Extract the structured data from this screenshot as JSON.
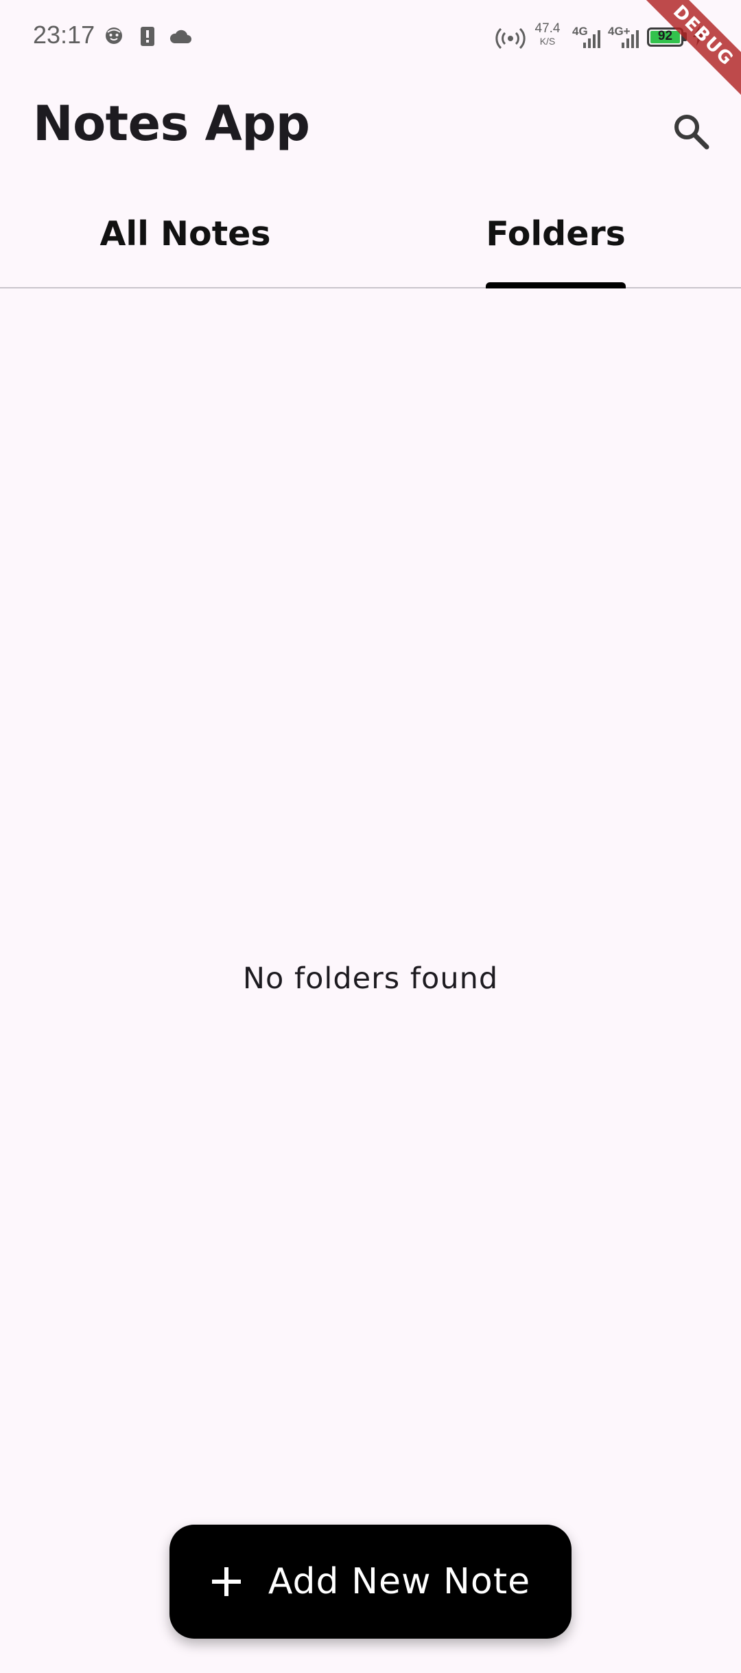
{
  "status_bar": {
    "time": "23:17",
    "net_speed_value": "47.4",
    "net_speed_unit": "K/S",
    "signal_1_label": "4G",
    "signal_2_label": "4G+",
    "battery_level": "92",
    "icons": [
      "face-notification-icon",
      "sim-alert-icon",
      "cloud-icon",
      "hotspot-icon",
      "signal-icon",
      "signal-icon",
      "battery-icon",
      "charging-icon"
    ],
    "battery_color": "#33c24d"
  },
  "debug_banner": "DEBUG",
  "app_bar": {
    "title": "Notes App",
    "search_icon": "search-icon"
  },
  "tabs": [
    {
      "label": "All Notes",
      "selected": false
    },
    {
      "label": "Folders",
      "selected": true
    }
  ],
  "content": {
    "empty_message": "No folders found"
  },
  "fab": {
    "icon": "plus-icon",
    "label": "Add New Note",
    "background": "#000000"
  }
}
